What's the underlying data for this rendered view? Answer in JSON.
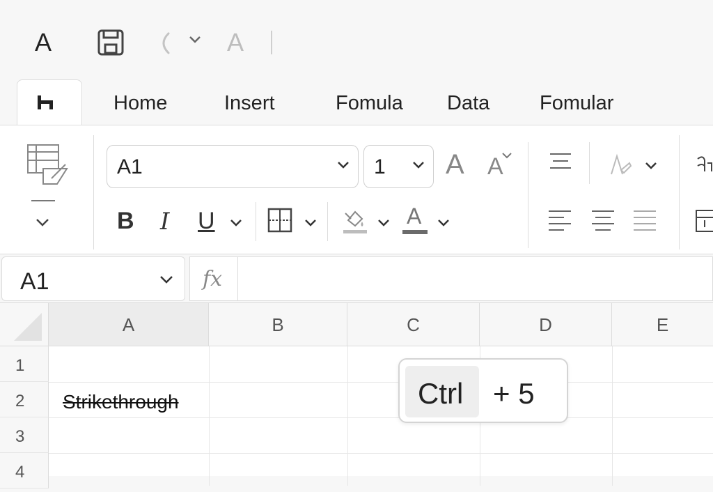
{
  "quick_access": {
    "app_letter": "A",
    "format_letter": "A"
  },
  "tabs": {
    "active_glyph": "h",
    "items": [
      "Home",
      "Insert",
      "Fomula",
      "Data",
      "Fomular"
    ]
  },
  "ribbon": {
    "font_name": "A1",
    "font_size": "1",
    "grow_font": "A",
    "shrink_font": "A",
    "bold": "B",
    "italic": "I",
    "underline": "U",
    "font_color_letter": "A",
    "font_color": "#6b6b6b",
    "fill_color": "#bdbdbd"
  },
  "formula_bar": {
    "name_box": "A1",
    "fx_label": "fx",
    "formula": ""
  },
  "grid": {
    "columns": [
      "A",
      "B",
      "C",
      "D",
      "E"
    ],
    "rows": [
      "1",
      "2",
      "3",
      "4"
    ],
    "cells": {
      "A2": "Strikethrough"
    }
  },
  "shortcut": {
    "key": "Ctrl",
    "plus_key": "+ 5"
  }
}
